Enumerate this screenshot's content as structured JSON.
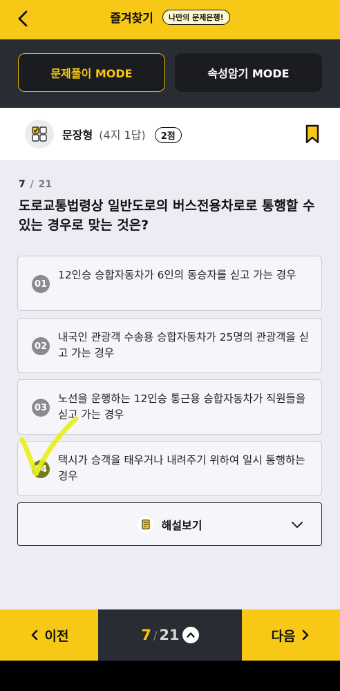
{
  "header": {
    "title": "즐겨찾기",
    "pill": "나만의 문제은행!"
  },
  "modes": {
    "active": "문제풀이 MODE",
    "inactive": "속성암기 MODE"
  },
  "qtype": {
    "name": "문장형",
    "sub": "(4지 1답)",
    "points": "2점"
  },
  "question": {
    "current": "7",
    "separator": "/",
    "total": "21",
    "text": "도로교통법령상 일반도로의 버스전용차로로 통행할 수 있는 경우로 맞는 것은?"
  },
  "options": [
    {
      "num": "01",
      "text": "12인승 승합자동차가 6인의 동승자를 싣고 가는 경우"
    },
    {
      "num": "02",
      "text": "내국인 관광객 수송용 승합자동차가 25명의 관광객을 싣고 가는 경우"
    },
    {
      "num": "03",
      "text": "노선을 운행하는 12인승 통근용 승합자동차가 직원들을 싣고 가는 경우"
    },
    {
      "num": "04",
      "text": "택시가 승객을 태우거나 내려주기 위하여 일시 통행하는 경우"
    }
  ],
  "explanation": {
    "label": "해설보기"
  },
  "footer": {
    "prev": "이전",
    "next": "다음",
    "current": "7",
    "separator": "/",
    "total": "21"
  },
  "colors": {
    "accent": "#f7c815",
    "dark": "#2a2c34",
    "selected": "#787a1a",
    "check": "#e8ee1c"
  }
}
